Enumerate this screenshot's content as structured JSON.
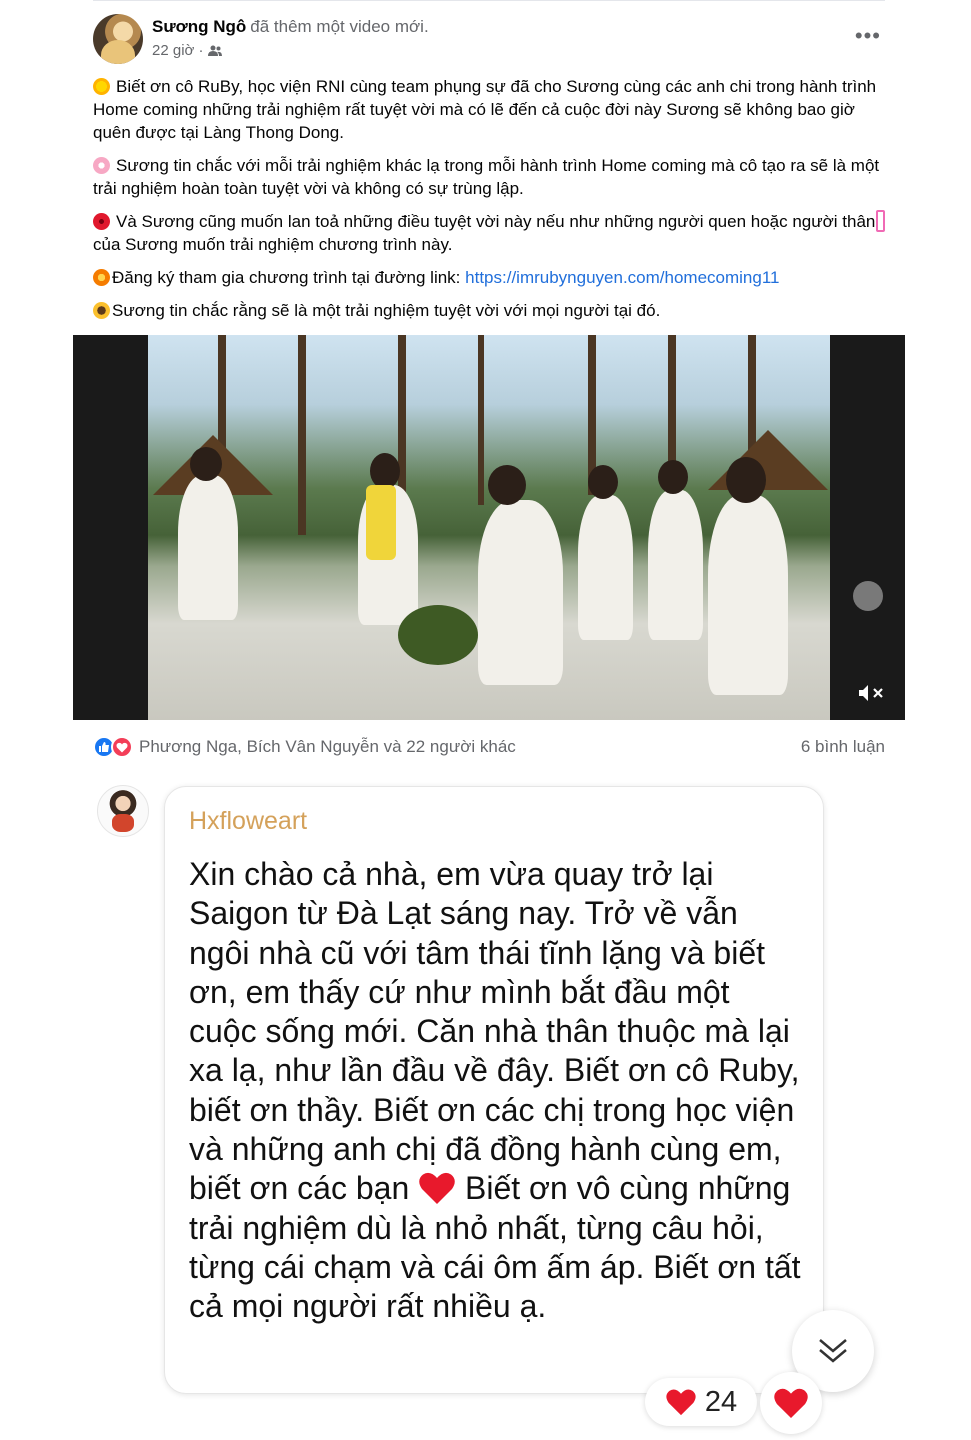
{
  "post": {
    "author_name": "Sương Ngô",
    "author_action": "đã thêm một video mới.",
    "timestamp": "22 giờ ·",
    "paragraphs": {
      "p1": "Biết ơn cô RuBy, học viện RNI cùng team phụng sự đã cho Sương cùng các anh chi trong hành trình Home coming những trải nghiệm rất tuyệt vời mà có lẽ đến cả cuộc đời này Sương sẽ không bao giờ quên được tại Làng Thong Dong.",
      "p2": "Sương tin chắc với mỗi trải nghiệm khác lạ trong mỗi hành trình Home coming mà cô tạo ra sẽ là một trải nghiệm hoàn toàn tuyệt vời và không có sự trùng lập.",
      "p3_before": "Và Sương cũng muốn lan toả những điều tuyệt vời này nếu như những người quen hoặc người thân",
      "p3_after": "của Sương muốn trải nghiệm chương trình này.",
      "p4_text": "Đăng ký tham gia chương trình tại đường link:",
      "p4_link": "https://imrubynguyen.com/homecoming11",
      "p5": "Sương tin chắc rằng sẽ là một trải nghiệm tuyệt vời với mọi người tại đó."
    },
    "emoji_icons": [
      "sun-icon",
      "cherry-blossom-icon",
      "hibiscus-icon",
      "blossom-icon",
      "sunflower-icon"
    ],
    "reactors": "Phương Nga, Bích Vân Nguyễn và 22 người khác",
    "comments_count": "6 bình luận"
  },
  "comment": {
    "author": "Hxfloweart",
    "text_part1": "Xin chào cả nhà, em vừa quay trở lại Saigon từ Đà Lạt sáng nay. Trở về vẫn ngôi nhà cũ với tâm thái tĩnh lặng và biết ơn, em thấy cứ như mình bắt đầu một cuộc sống mới. Căn nhà thân thuộc mà lại xa lạ, như lần đầu về đây. Biết ơn cô Ruby, biết ơn thầy. Biết ơn các chị trong học viện và những anh chị đã đồng hành cùng em, biết ơn các bạn",
    "text_part2": " Biết ơn vô cùng những trải nghiệm dù là nhỏ nhất, từng câu hỏi, từng cái chạm và cái ôm ấm áp. Biết ơn tất cả mọi người rất nhiều ạ.",
    "like_count": "24"
  },
  "colors": {
    "link": "#216fdb",
    "secondary_text": "#65676b",
    "comment_author": "#d4a15a",
    "heart": "#e8192c",
    "like_blue": "#1877f2"
  }
}
